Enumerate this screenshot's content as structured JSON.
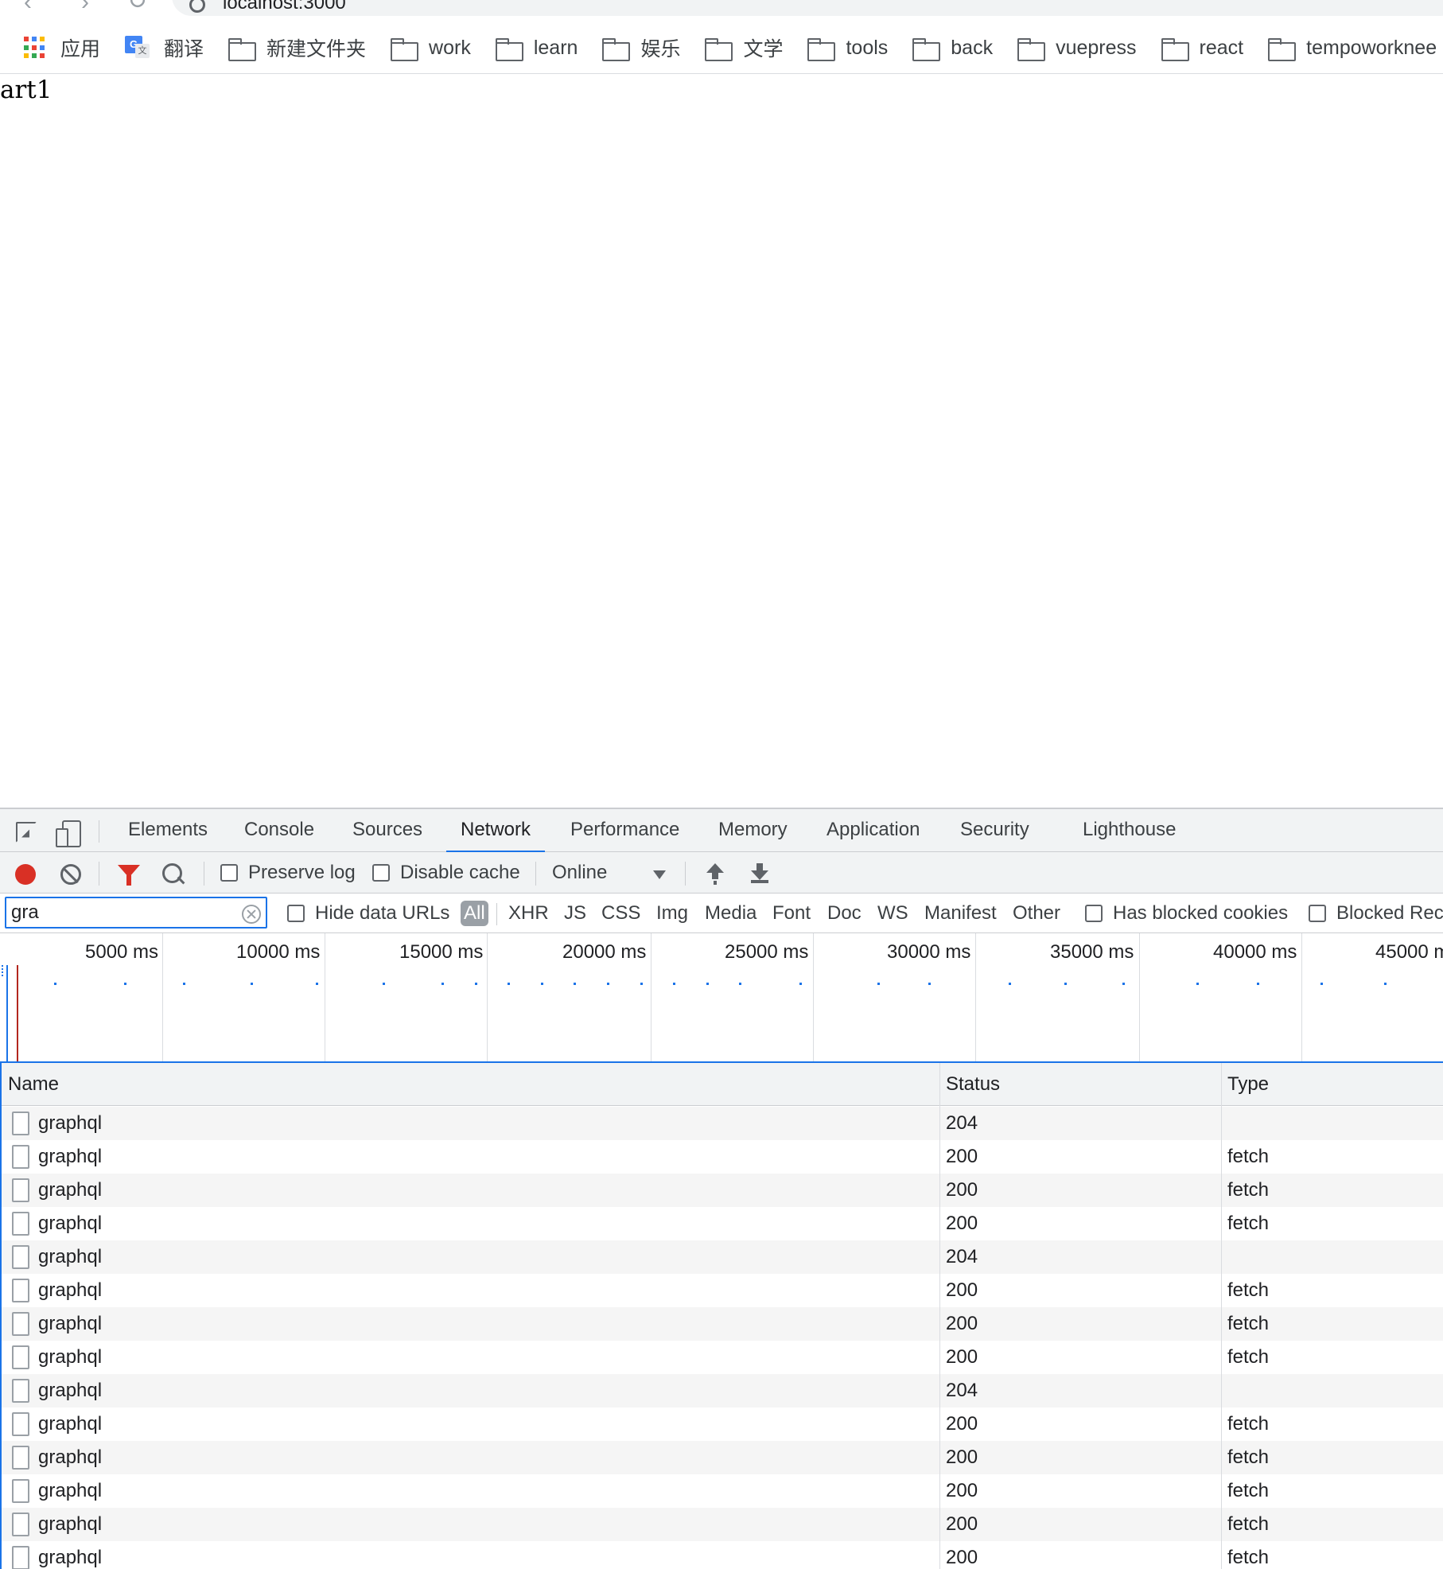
{
  "browser": {
    "url": "localhost:3000",
    "bookmarks": [
      {
        "label": "应用",
        "icon": "apps-grid-icon"
      },
      {
        "label": "翻译",
        "icon": "google-translate-icon"
      },
      {
        "label": "新建文件夹",
        "icon": "folder-icon"
      },
      {
        "label": "work",
        "icon": "folder-icon"
      },
      {
        "label": "learn",
        "icon": "folder-icon"
      },
      {
        "label": "娱乐",
        "icon": "folder-icon"
      },
      {
        "label": "文学",
        "icon": "folder-icon"
      },
      {
        "label": "tools",
        "icon": "folder-icon"
      },
      {
        "label": "back",
        "icon": "folder-icon"
      },
      {
        "label": "vuepress",
        "icon": "folder-icon"
      },
      {
        "label": "react",
        "icon": "folder-icon"
      },
      {
        "label": "tempoworknee",
        "icon": "folder-icon"
      }
    ]
  },
  "page": {
    "text": "art1"
  },
  "devtools": {
    "tabs": [
      "Elements",
      "Console",
      "Sources",
      "Network",
      "Performance",
      "Memory",
      "Application",
      "Security",
      "Lighthouse"
    ],
    "active_tab": "Network",
    "toolbar": {
      "preserve_log": "Preserve log",
      "disable_cache": "Disable cache",
      "throttling": "Online"
    },
    "filter": {
      "value": "gra",
      "hide_data_urls": "Hide data URLs",
      "types": [
        "All",
        "XHR",
        "JS",
        "CSS",
        "Img",
        "Media",
        "Font",
        "Doc",
        "WS",
        "Manifest",
        "Other"
      ],
      "active_type": "All",
      "has_blocked_cookies": "Has blocked cookies",
      "blocked_requests": "Blocked Rec"
    },
    "overview": {
      "ticks": [
        "5000 ms",
        "10000 ms",
        "15000 ms",
        "20000 ms",
        "25000 ms",
        "30000 ms",
        "35000 ms",
        "40000 ms",
        "45000 m"
      ]
    },
    "table": {
      "columns": [
        "Name",
        "Status",
        "Type"
      ],
      "rows": [
        {
          "name": "graphql",
          "status": "204",
          "type": ""
        },
        {
          "name": "graphql",
          "status": "200",
          "type": "fetch"
        },
        {
          "name": "graphql",
          "status": "200",
          "type": "fetch"
        },
        {
          "name": "graphql",
          "status": "200",
          "type": "fetch"
        },
        {
          "name": "graphql",
          "status": "204",
          "type": ""
        },
        {
          "name": "graphql",
          "status": "200",
          "type": "fetch"
        },
        {
          "name": "graphql",
          "status": "200",
          "type": "fetch"
        },
        {
          "name": "graphql",
          "status": "200",
          "type": "fetch"
        },
        {
          "name": "graphql",
          "status": "204",
          "type": ""
        },
        {
          "name": "graphql",
          "status": "200",
          "type": "fetch"
        },
        {
          "name": "graphql",
          "status": "200",
          "type": "fetch"
        },
        {
          "name": "graphql",
          "status": "200",
          "type": "fetch"
        },
        {
          "name": "graphql",
          "status": "200",
          "type": "fetch"
        },
        {
          "name": "graphql",
          "status": "200",
          "type": "fetch"
        }
      ]
    }
  },
  "colors": {
    "accent": "#1a73e8",
    "record": "#d93025",
    "panel_bg": "#f1f3f4"
  }
}
